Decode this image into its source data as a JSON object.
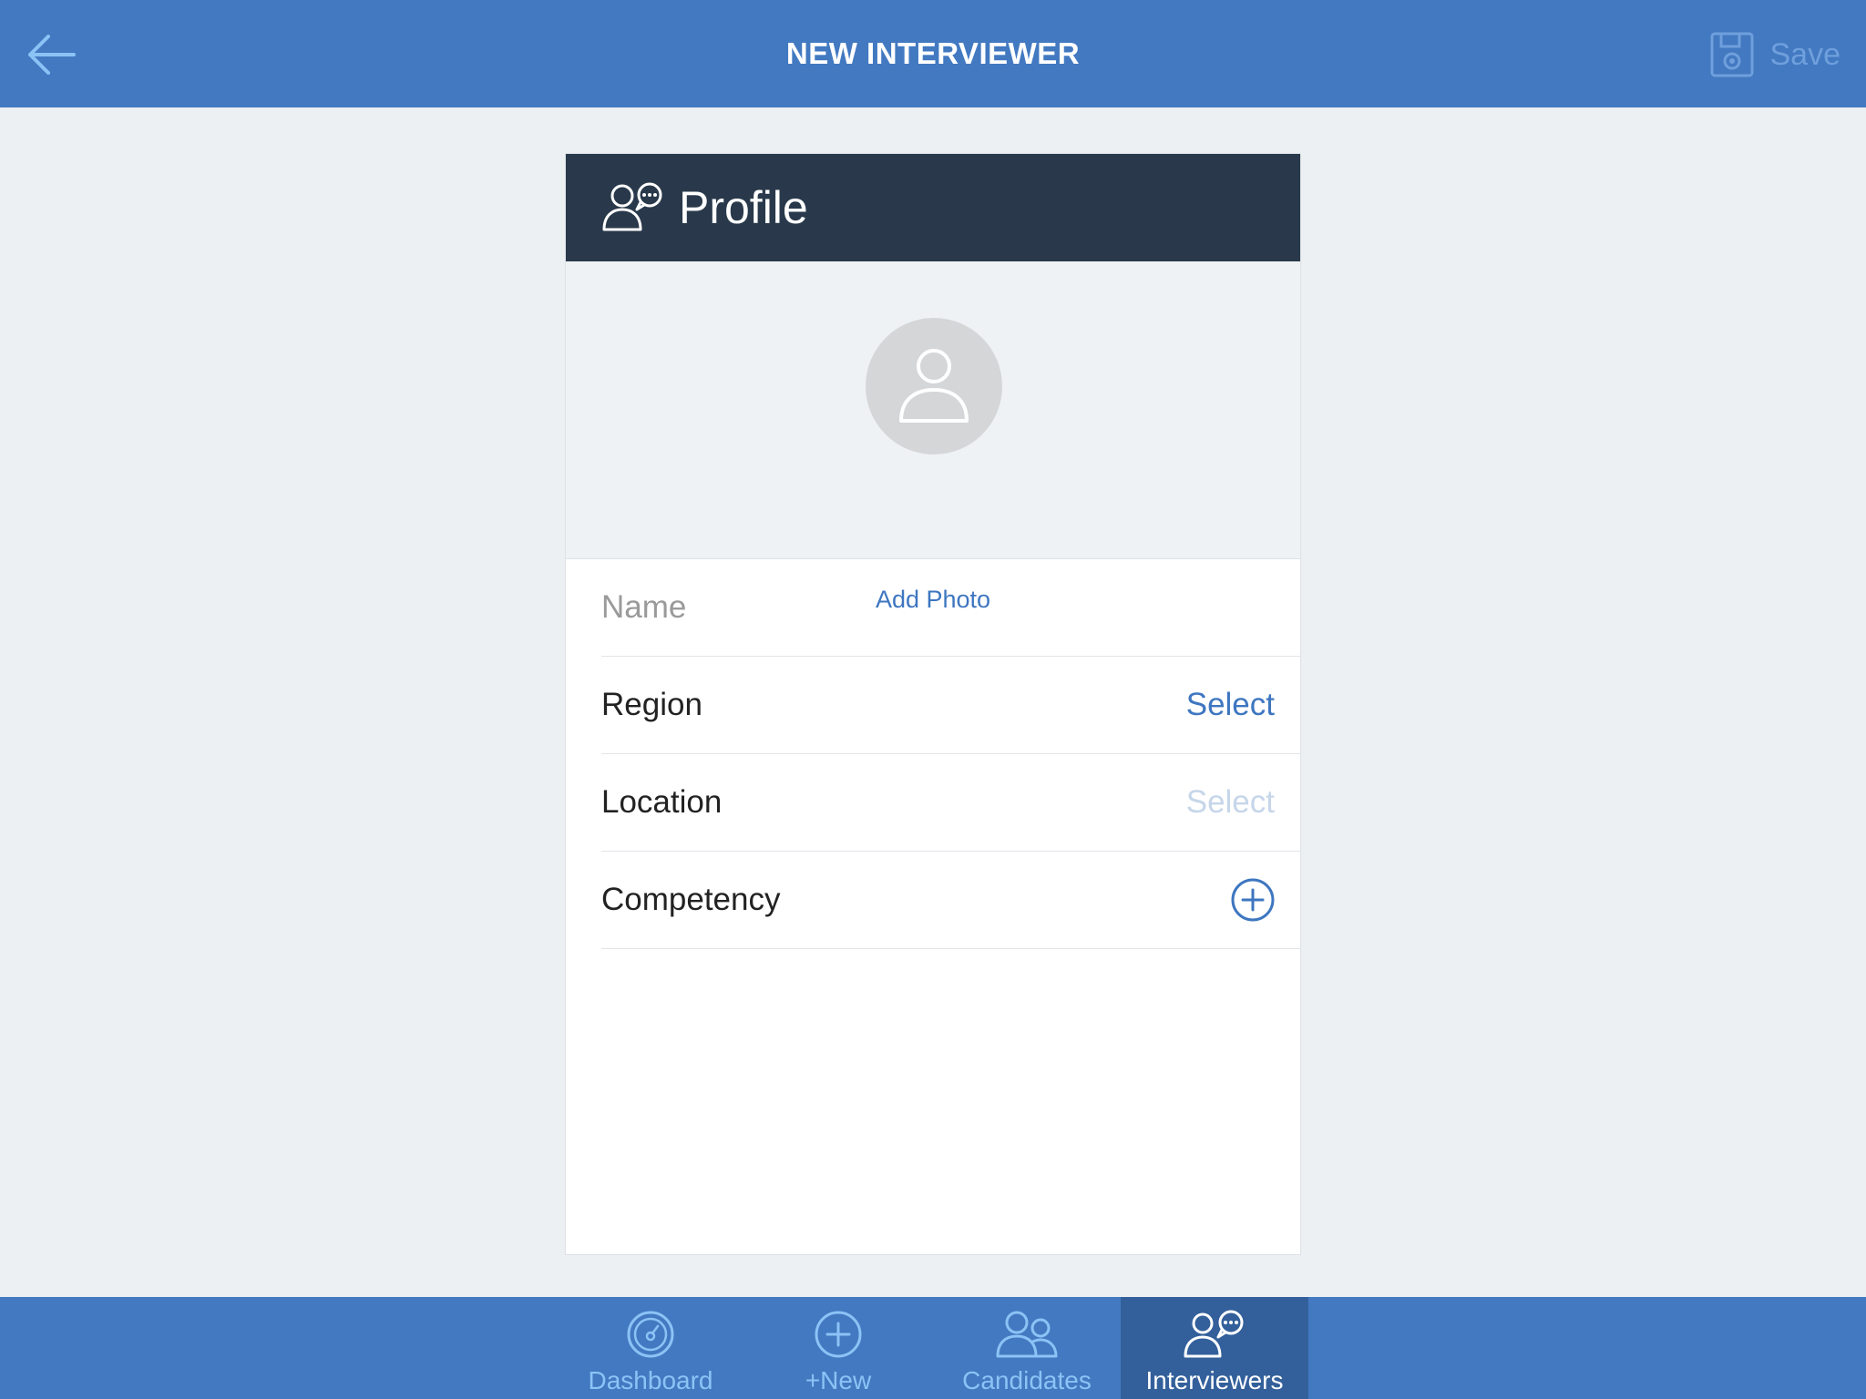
{
  "header": {
    "title": "NEW INTERVIEWER",
    "save_label": "Save",
    "back_icon": "arrow-left-icon",
    "save_icon": "floppy-disk-icon"
  },
  "profile": {
    "title": "Profile",
    "header_icon": "interviewers-chat-icon",
    "add_photo_label": "Add Photo"
  },
  "form": {
    "name_placeholder": "Name",
    "name_value": "",
    "region_label": "Region",
    "region_value": "Select",
    "location_label": "Location",
    "location_value": "Select",
    "competency_label": "Competency"
  },
  "tabs": [
    {
      "label": "Dashboard",
      "icon": "dashboard-gauge-icon",
      "active": false
    },
    {
      "label": "+New",
      "icon": "plus-circle-icon",
      "active": false
    },
    {
      "label": "Candidates",
      "icon": "candidates-group-icon",
      "active": false
    },
    {
      "label": "Interviewers",
      "icon": "interviewers-chat-icon",
      "active": true
    }
  ],
  "colors": {
    "nav_blue": "#4279c1",
    "active_tab": "#33609b",
    "card_header": "#29394b",
    "link_blue": "#3e76c0",
    "disabled_link": "#c6d6ea",
    "background": "#ecf0f2"
  }
}
